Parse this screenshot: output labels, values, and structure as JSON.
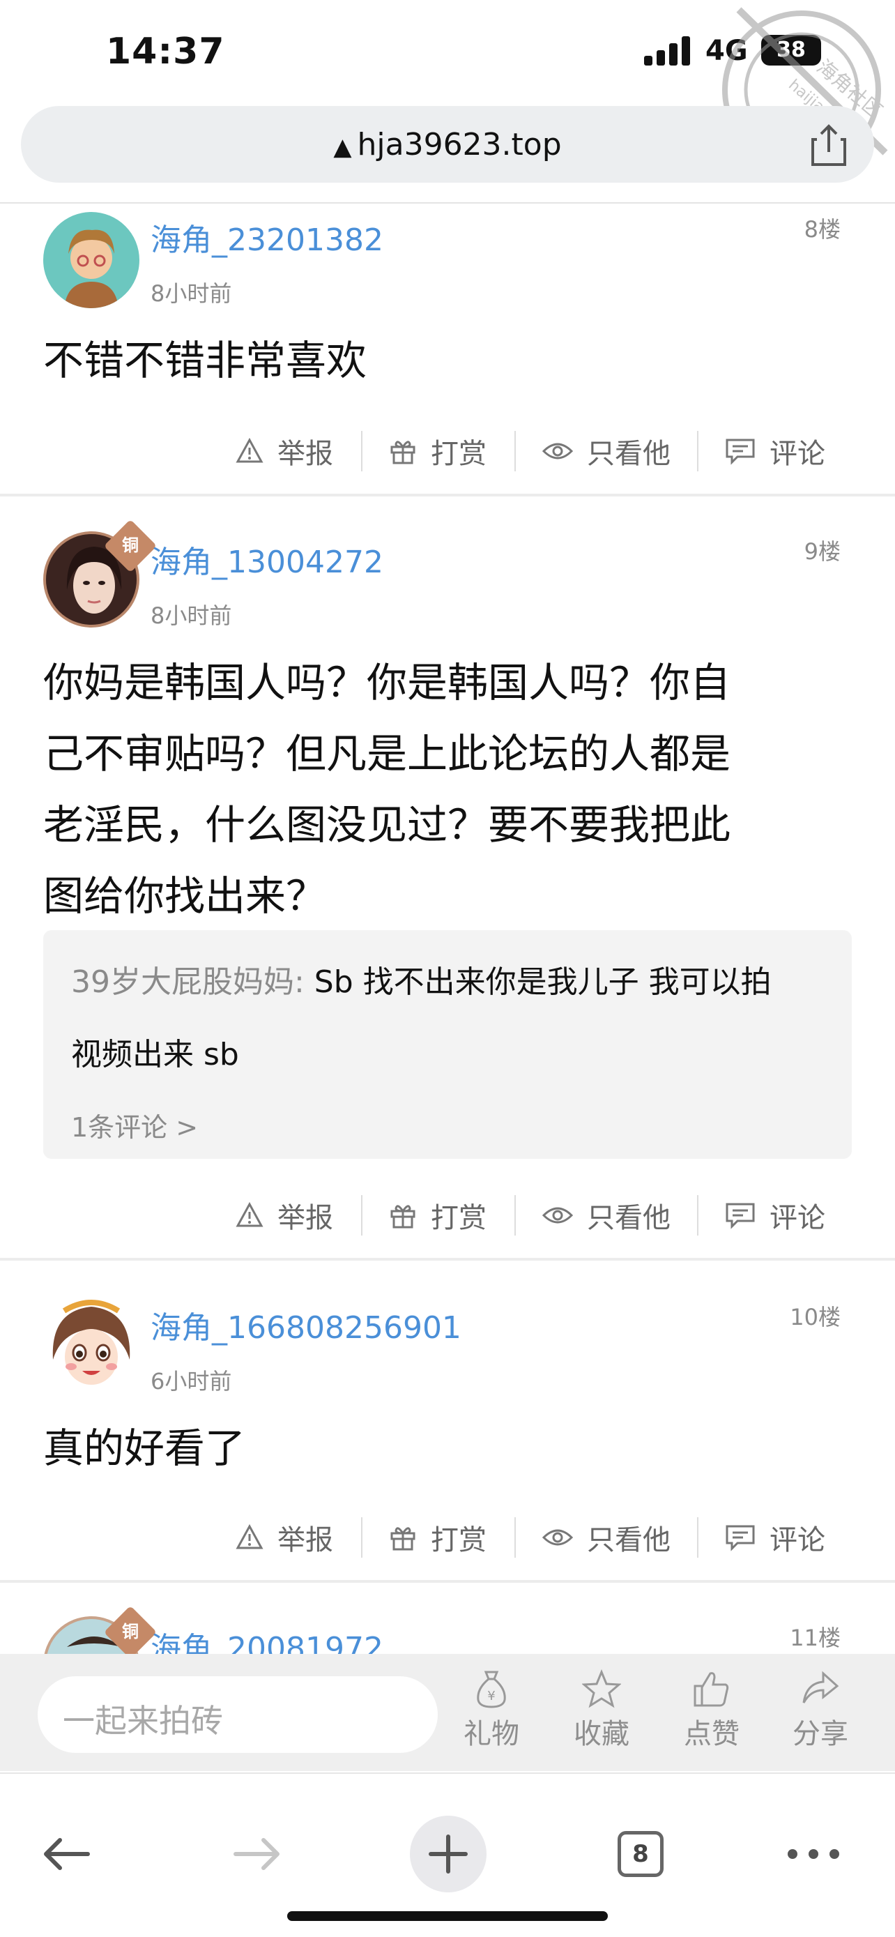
{
  "status": {
    "time": "14:37",
    "network": "4G",
    "battery": "38"
  },
  "watermark": {
    "text": "海角社区",
    "url": "haijiao.com"
  },
  "browser": {
    "url": "hja39623.top"
  },
  "actions": {
    "report": "举报",
    "reward": "打赏",
    "only_him": "只看他",
    "comment": "评论"
  },
  "posts": [
    {
      "username": "海角_23201382",
      "time": "8小时前",
      "floor": "8楼",
      "lines": [
        "不错不错非常喜欢"
      ],
      "medal": ""
    },
    {
      "username": "海角_13004272",
      "time": "8小时前",
      "floor": "9楼",
      "medal": "铜",
      "lines": [
        "你妈是韩国人吗？你是韩国人吗？你自",
        "己不审贴吗？但凡是上此论坛的人都是",
        "老淫民，什么图没见过？要不要我把此",
        "图给你找出来？"
      ],
      "reply": {
        "user": "39岁大屁股妈妈:",
        "text1": " Sb 找不出来你是我儿子 我可以拍",
        "text2": "视频出来 sb",
        "more": "1条评论 >"
      }
    },
    {
      "username": "海角_166808256901",
      "time": "6小时前",
      "floor": "10楼",
      "lines": [
        "真的好看了"
      ],
      "medal": ""
    },
    {
      "username": "海角_20081972",
      "floor": "11楼",
      "medal": "铜"
    }
  ],
  "comment_bar": {
    "placeholder": "一起来拍砖",
    "gift": "礼物",
    "favorite": "收藏",
    "like": "点赞",
    "share": "分享"
  },
  "toolbar": {
    "tab_count": "8"
  }
}
